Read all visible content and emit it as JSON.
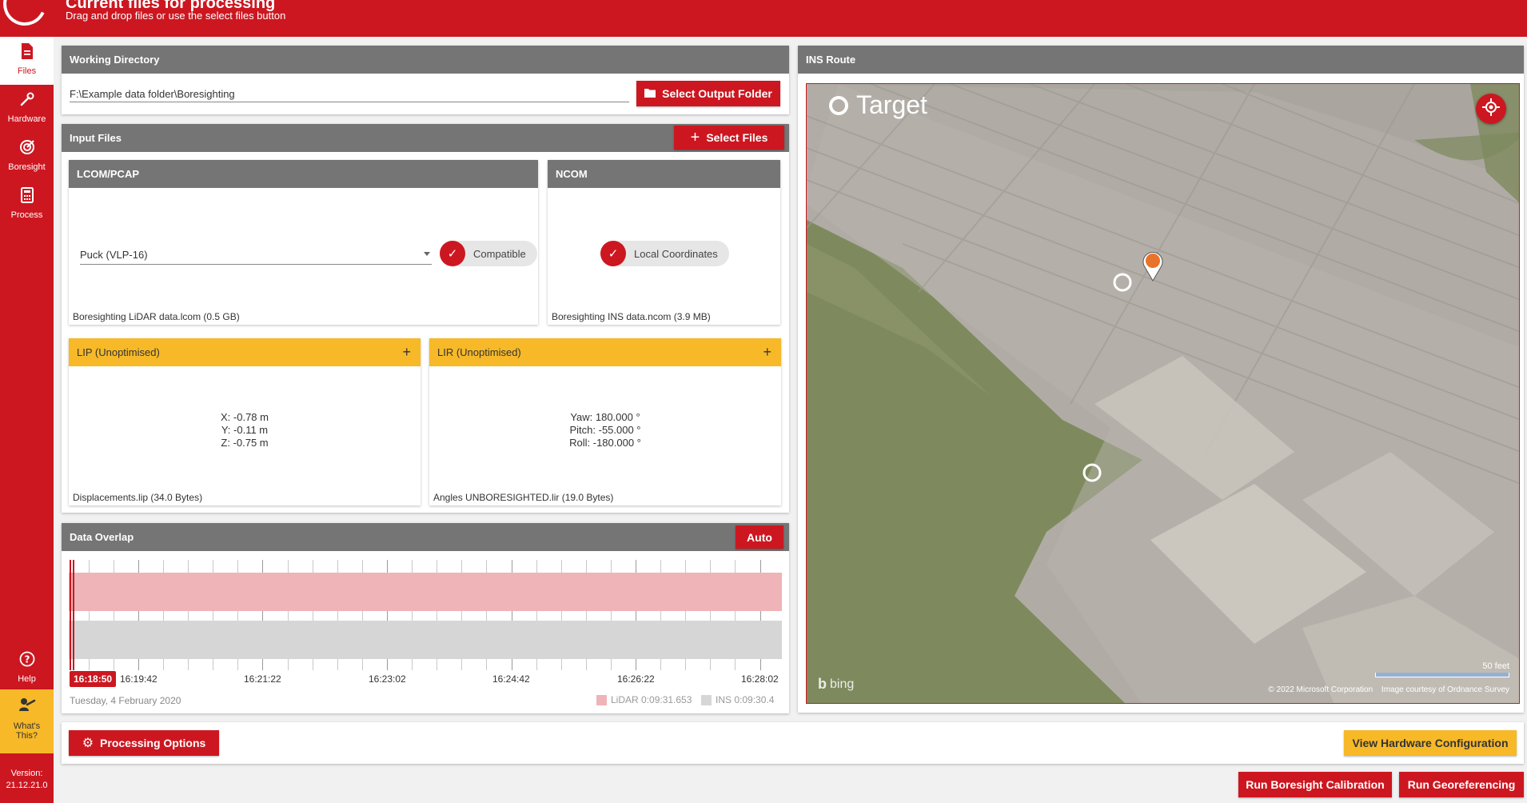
{
  "header": {
    "title": "Current files for processing",
    "subtitle": "Drag and drop files or use the select files button"
  },
  "sidebar": {
    "items": [
      {
        "label": "Files",
        "icon": "file-icon"
      },
      {
        "label": "Hardware",
        "icon": "wrench-icon"
      },
      {
        "label": "Boresight",
        "icon": "target-icon"
      },
      {
        "label": "Process",
        "icon": "calculator-icon"
      }
    ],
    "help_label": "Help",
    "whats_this_line1": "What's",
    "whats_this_line2": "This?",
    "version_label": "Version:",
    "version_value": "21.12.21.0"
  },
  "working_directory": {
    "title": "Working Directory",
    "path": "F:\\Example data folder\\Boresighting",
    "button_label": "Select Output Folder"
  },
  "input_files": {
    "title": "Input Files",
    "button_label": "Select Files",
    "lcom": {
      "title": "LCOM/PCAP",
      "device": "Puck (VLP-16)",
      "chip": "Compatible",
      "file": "Boresighting LiDAR data.lcom (0.5 GB)"
    },
    "ncom": {
      "title": "NCOM",
      "chip": "Local Coordinates",
      "file": "Boresighting INS data.ncom (3.9 MB)"
    },
    "lip": {
      "title": "LIP (Unoptimised)",
      "x": "X: -0.78 m",
      "y": "Y: -0.11 m",
      "z": "Z: -0.75 m",
      "file": "Displacements.lip (34.0 Bytes)"
    },
    "lir": {
      "title": "LIR (Unoptimised)",
      "yaw": "Yaw: 180.000 °",
      "pitch": "Pitch: -55.000 °",
      "roll": "Roll: -180.000 °",
      "file": "Angles UNBORESIGHTED.lir (19.0 Bytes)"
    }
  },
  "data_overlap": {
    "title": "Data Overlap",
    "auto_label": "Auto",
    "start_time": "16:18:50",
    "ticks": [
      "16:19:42",
      "16:21:22",
      "16:23:02",
      "16:24:42",
      "16:26:22",
      "16:28:02"
    ],
    "date": "Tuesday, 4 February 2020",
    "lidar_legend": "LiDAR 0:09:31.653",
    "ins_legend": "INS 0:09:30.4",
    "lidar_color": "#eeb4b8",
    "ins_color": "#d6d6d6"
  },
  "ins_route": {
    "title": "INS Route",
    "target_label": "Target",
    "scale_label": "50 feet",
    "attribution_left": "© 2022 Microsoft Corporation",
    "attribution_right": "Image courtesy of Ordnance Survey",
    "bing_label": "bing"
  },
  "bottom": {
    "processing_options": "Processing Options",
    "view_hardware": "View Hardware Configuration",
    "run_boresight": "Run Boresight Calibration",
    "run_georef": "Run Georeferencing"
  }
}
